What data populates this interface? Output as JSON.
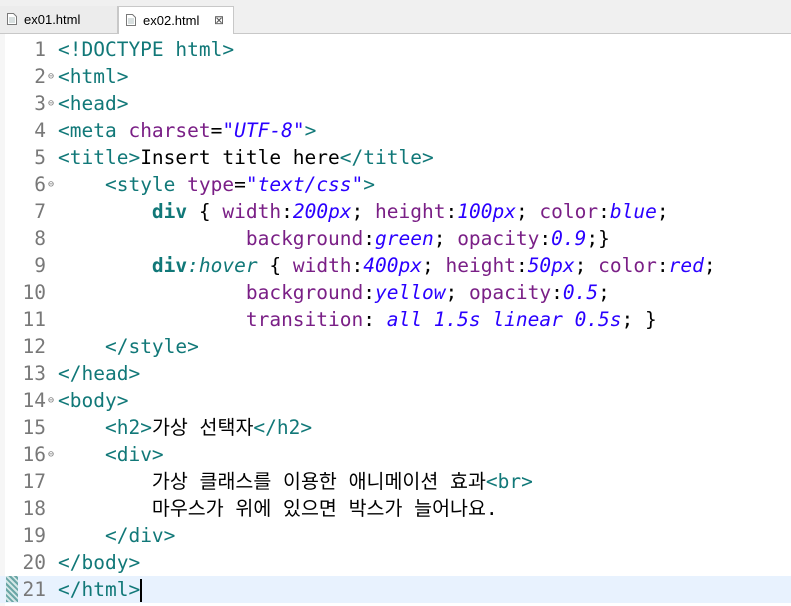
{
  "tabs": [
    {
      "label": "ex01.html",
      "active": false
    },
    {
      "label": "ex02.html",
      "active": true,
      "close": "⊠"
    }
  ],
  "editor": {
    "lines": [
      {
        "num": "1",
        "fold": "",
        "tokens": [
          [
            "t-tag",
            "<!DOCTYPE html>"
          ]
        ]
      },
      {
        "num": "2",
        "fold": "⊖",
        "tokens": [
          [
            "t-tag",
            "<html>"
          ]
        ]
      },
      {
        "num": "3",
        "fold": "⊖",
        "tokens": [
          [
            "t-tag",
            "<head>"
          ]
        ]
      },
      {
        "num": "4",
        "fold": "",
        "tokens": [
          [
            "t-tag",
            "<meta "
          ],
          [
            "t-attr",
            "charset"
          ],
          [
            "t-text",
            "="
          ],
          [
            "t-str",
            "\"UTF-8\""
          ],
          [
            "t-tag",
            ">"
          ]
        ]
      },
      {
        "num": "5",
        "fold": "",
        "tokens": [
          [
            "t-tag",
            "<title>"
          ],
          [
            "t-text",
            "Insert title here"
          ],
          [
            "t-tag",
            "</title>"
          ]
        ]
      },
      {
        "num": "6",
        "fold": "⊖",
        "tokens": [
          [
            "t-text",
            "    "
          ],
          [
            "t-tag",
            "<style "
          ],
          [
            "t-attr",
            "type"
          ],
          [
            "t-text",
            "="
          ],
          [
            "t-str",
            "\"text/css\""
          ],
          [
            "t-tag",
            ">"
          ]
        ]
      },
      {
        "num": "7",
        "fold": "",
        "tokens": [
          [
            "t-text",
            "        "
          ],
          [
            "t-kw",
            "div"
          ],
          [
            "t-text",
            " { "
          ],
          [
            "t-prop",
            "width"
          ],
          [
            "t-text",
            ":"
          ],
          [
            "t-val",
            "200px"
          ],
          [
            "t-text",
            "; "
          ],
          [
            "t-prop",
            "height"
          ],
          [
            "t-text",
            ":"
          ],
          [
            "t-val",
            "100px"
          ],
          [
            "t-text",
            "; "
          ],
          [
            "t-prop",
            "color"
          ],
          [
            "t-text",
            ":"
          ],
          [
            "t-val",
            "blue"
          ],
          [
            "t-text",
            ";"
          ]
        ]
      },
      {
        "num": "8",
        "fold": "",
        "tokens": [
          [
            "t-text",
            "                "
          ],
          [
            "t-prop",
            "background"
          ],
          [
            "t-text",
            ":"
          ],
          [
            "t-val",
            "green"
          ],
          [
            "t-text",
            "; "
          ],
          [
            "t-prop",
            "opacity"
          ],
          [
            "t-text",
            ":"
          ],
          [
            "t-val",
            "0.9"
          ],
          [
            "t-text",
            ";}"
          ]
        ]
      },
      {
        "num": "9",
        "fold": "",
        "tokens": [
          [
            "t-text",
            "        "
          ],
          [
            "t-kw",
            "div"
          ],
          [
            "t-pseudo",
            ":hover"
          ],
          [
            "t-text",
            " { "
          ],
          [
            "t-prop",
            "width"
          ],
          [
            "t-text",
            ":"
          ],
          [
            "t-val",
            "400px"
          ],
          [
            "t-text",
            "; "
          ],
          [
            "t-prop",
            "height"
          ],
          [
            "t-text",
            ":"
          ],
          [
            "t-val",
            "50px"
          ],
          [
            "t-text",
            "; "
          ],
          [
            "t-prop",
            "color"
          ],
          [
            "t-text",
            ":"
          ],
          [
            "t-val",
            "red"
          ],
          [
            "t-text",
            ";"
          ]
        ]
      },
      {
        "num": "10",
        "fold": "",
        "tokens": [
          [
            "t-text",
            "                "
          ],
          [
            "t-prop",
            "background"
          ],
          [
            "t-text",
            ":"
          ],
          [
            "t-val",
            "yellow"
          ],
          [
            "t-text",
            "; "
          ],
          [
            "t-prop",
            "opacity"
          ],
          [
            "t-text",
            ":"
          ],
          [
            "t-val",
            "0.5"
          ],
          [
            "t-text",
            ";"
          ]
        ]
      },
      {
        "num": "11",
        "fold": "",
        "tokens": [
          [
            "t-text",
            "                "
          ],
          [
            "t-prop",
            "transition"
          ],
          [
            "t-text",
            ": "
          ],
          [
            "t-val",
            "all 1.5s linear 0.5s"
          ],
          [
            "t-text",
            "; }"
          ]
        ]
      },
      {
        "num": "12",
        "fold": "",
        "tokens": [
          [
            "t-text",
            "    "
          ],
          [
            "t-tag",
            "</style>"
          ]
        ]
      },
      {
        "num": "13",
        "fold": "",
        "tokens": [
          [
            "t-tag",
            "</head>"
          ]
        ]
      },
      {
        "num": "14",
        "fold": "⊖",
        "tokens": [
          [
            "t-tag",
            "<body>"
          ]
        ]
      },
      {
        "num": "15",
        "fold": "",
        "tokens": [
          [
            "t-text",
            "    "
          ],
          [
            "t-tag",
            "<h2>"
          ],
          [
            "t-text",
            "가상 선택자"
          ],
          [
            "t-tag",
            "</h2>"
          ]
        ]
      },
      {
        "num": "16",
        "fold": "⊖",
        "tokens": [
          [
            "t-text",
            "    "
          ],
          [
            "t-tag",
            "<div>"
          ]
        ]
      },
      {
        "num": "17",
        "fold": "",
        "tokens": [
          [
            "t-text",
            "        가상 클래스를 이용한 애니메이션 효과"
          ],
          [
            "t-tag",
            "<br>"
          ]
        ]
      },
      {
        "num": "18",
        "fold": "",
        "tokens": [
          [
            "t-text",
            "        마우스가 위에 있으면 박스가 늘어나요."
          ]
        ]
      },
      {
        "num": "19",
        "fold": "",
        "tokens": [
          [
            "t-text",
            "    "
          ],
          [
            "t-tag",
            "</div>"
          ]
        ]
      },
      {
        "num": "20",
        "fold": "",
        "tokens": [
          [
            "t-tag",
            "</body>"
          ]
        ]
      },
      {
        "num": "21",
        "fold": "",
        "tokens": [
          [
            "t-tag",
            "</html>"
          ]
        ],
        "current": true
      }
    ]
  }
}
